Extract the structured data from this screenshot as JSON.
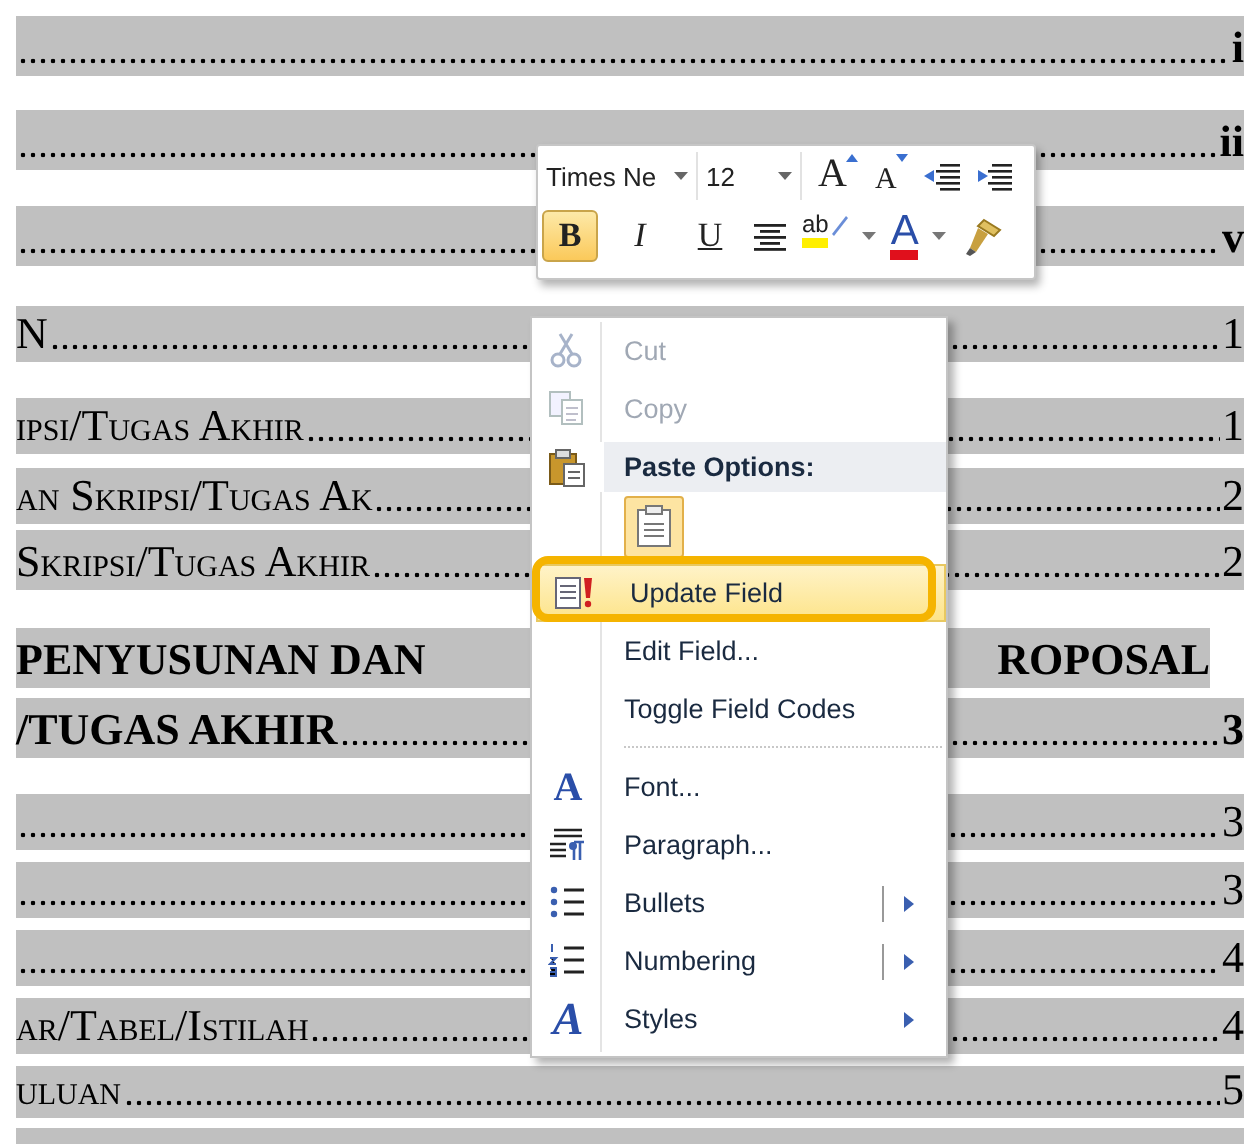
{
  "document": {
    "rows": [
      {
        "kind": "bold",
        "page": "i"
      },
      {
        "kind": "bold",
        "page": "ii"
      },
      {
        "kind": "bold",
        "page": "v"
      },
      {
        "kind": "plain",
        "text": "N",
        "page": "1"
      },
      {
        "kind": "smallcaps",
        "text": "ipsi/Tugas Akhir",
        "page": "1"
      },
      {
        "kind": "smallcaps",
        "text": "an Skripsi/Tugas Ak",
        "page": "2"
      },
      {
        "kind": "smallcaps",
        "text": "Skripsi/Tugas Akhir",
        "page": "2"
      },
      {
        "kind": "split",
        "text": "PENYUSUNAN DAN",
        "right_text": "ROPOSAL"
      },
      {
        "kind": "bold",
        "text": "/TUGAS AKHIR",
        "page": "3"
      },
      {
        "kind": "plain",
        "page": "3"
      },
      {
        "kind": "plain",
        "page": "3"
      },
      {
        "kind": "plain",
        "page": "4"
      },
      {
        "kind": "smallcaps",
        "text": "ar/Tabel/Istilah",
        "page": "4"
      },
      {
        "kind": "smallcaps",
        "text": "uluan",
        "page": "5"
      },
      {
        "kind": "blank"
      }
    ]
  },
  "mini_toolbar": {
    "font_name": "Times Ne",
    "font_size": "12",
    "row1": [
      {
        "kind": "grow",
        "glyph": "A"
      },
      {
        "kind": "shrink",
        "glyph": "A"
      },
      {
        "kind": "outdent"
      },
      {
        "kind": "indent"
      }
    ],
    "row2": [
      {
        "kind": "bold",
        "glyph": "B",
        "selected": true
      },
      {
        "kind": "italic",
        "glyph": "I",
        "selected": false
      },
      {
        "kind": "underline",
        "glyph": "U",
        "selected": false
      },
      {
        "kind": "center"
      },
      {
        "kind": "highlight",
        "glyph": "ab"
      },
      {
        "kind": "caret"
      },
      {
        "kind": "fontcolor",
        "glyph": "A"
      },
      {
        "kind": "caret"
      },
      {
        "kind": "painter"
      }
    ]
  },
  "context_menu": {
    "items": [
      {
        "kind": "item",
        "label": "Cut",
        "disabled": true,
        "selected": false
      },
      {
        "kind": "item",
        "label": "Copy",
        "disabled": true,
        "selected": false
      },
      {
        "kind": "header",
        "label": "Paste Options:"
      },
      {
        "kind": "paste"
      },
      {
        "kind": "item",
        "label": "Update Field",
        "disabled": false,
        "selected": true
      },
      {
        "kind": "item",
        "label": "Edit Field...",
        "disabled": false,
        "selected": false
      },
      {
        "kind": "item",
        "label": "Toggle Field Codes",
        "disabled": false,
        "selected": false
      },
      {
        "kind": "separator"
      },
      {
        "kind": "item",
        "glyph": "A",
        "label": "Font...",
        "disabled": false,
        "selected": false
      },
      {
        "kind": "item",
        "label": "Paragraph...",
        "disabled": false,
        "selected": false
      },
      {
        "kind": "split",
        "label": "Bullets",
        "disabled": false,
        "selected": false
      },
      {
        "kind": "split",
        "label": "Numbering",
        "disabled": false,
        "selected": false
      },
      {
        "kind": "submenu",
        "glyph": "A",
        "label": "Styles",
        "disabled": false,
        "selected": false
      }
    ]
  }
}
